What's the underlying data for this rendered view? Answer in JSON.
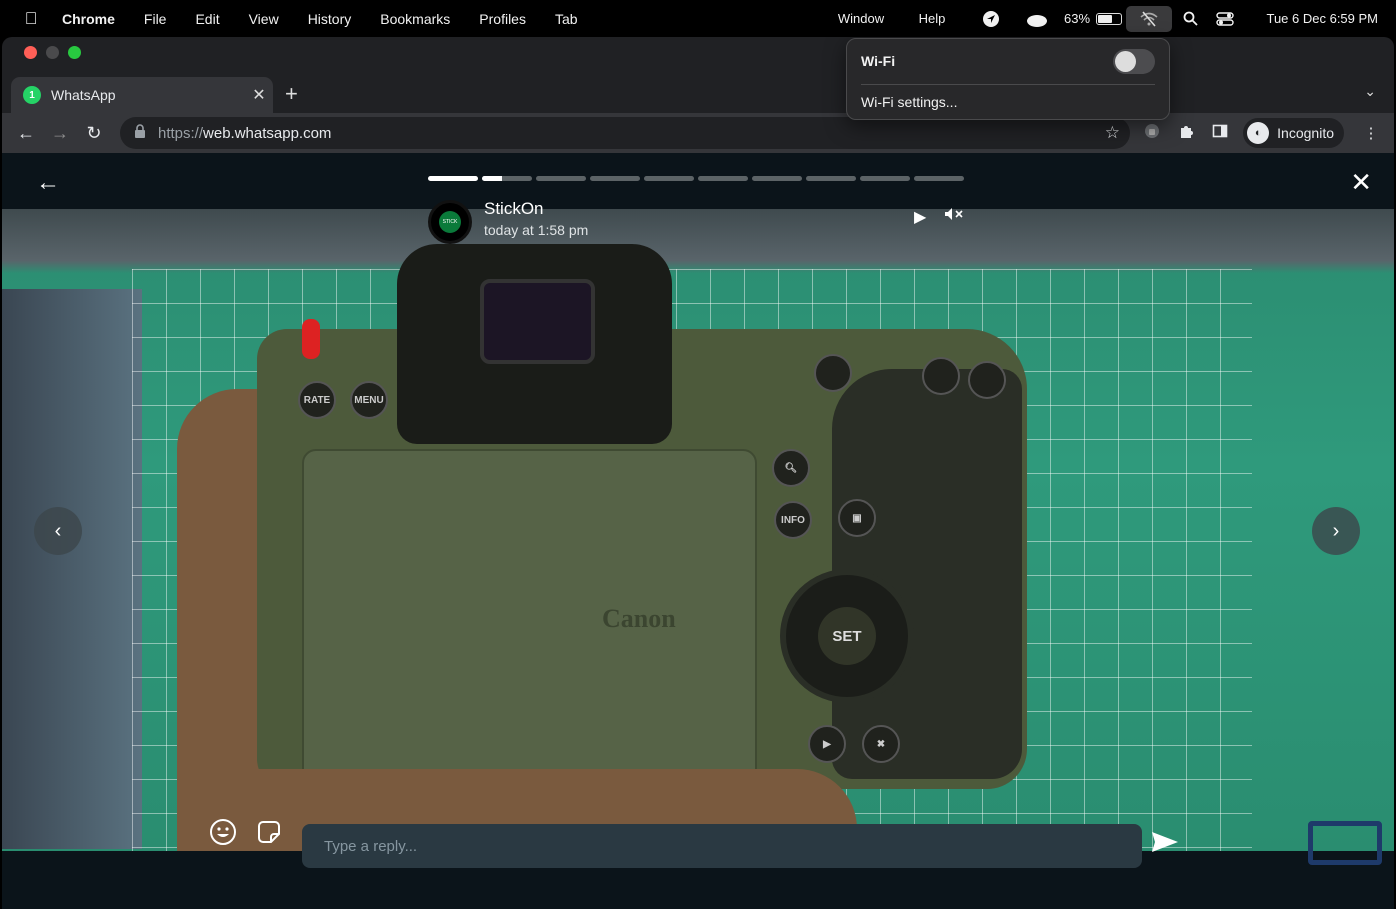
{
  "menubar": {
    "app_name": "Chrome",
    "items": [
      "File",
      "Edit",
      "View",
      "History",
      "Bookmarks",
      "Profiles",
      "Tab"
    ],
    "right_items": [
      "Window",
      "Help"
    ],
    "battery": "63%",
    "clock": "Tue 6 Dec  6:59 PM"
  },
  "wifi_menu": {
    "title": "Wi-Fi",
    "toggle_on": false,
    "settings": "Wi-Fi settings..."
  },
  "browser": {
    "tab_title": "WhatsApp",
    "tab_badge": "1",
    "url_scheme": "https://",
    "url_host": "web.whatsapp.com",
    "profile_label": "Incognito"
  },
  "status": {
    "poster_name": "StickOn",
    "poster_avatar_text": "STICK",
    "timestamp": "today at 1:58 pm",
    "segments_total": 10,
    "current_segment": 2,
    "current_segment_progress": 0.4,
    "reply_placeholder": "Type a reply...",
    "photo_brand_text": "Canon",
    "set_label": "SET",
    "rate_label": "RATE",
    "menu_label": "MENU",
    "info_label": "INFO"
  },
  "colors": {
    "whatsapp_green": "#25d366",
    "viewer_bg": "#0b141a",
    "reply_bg": "#2a3942"
  }
}
